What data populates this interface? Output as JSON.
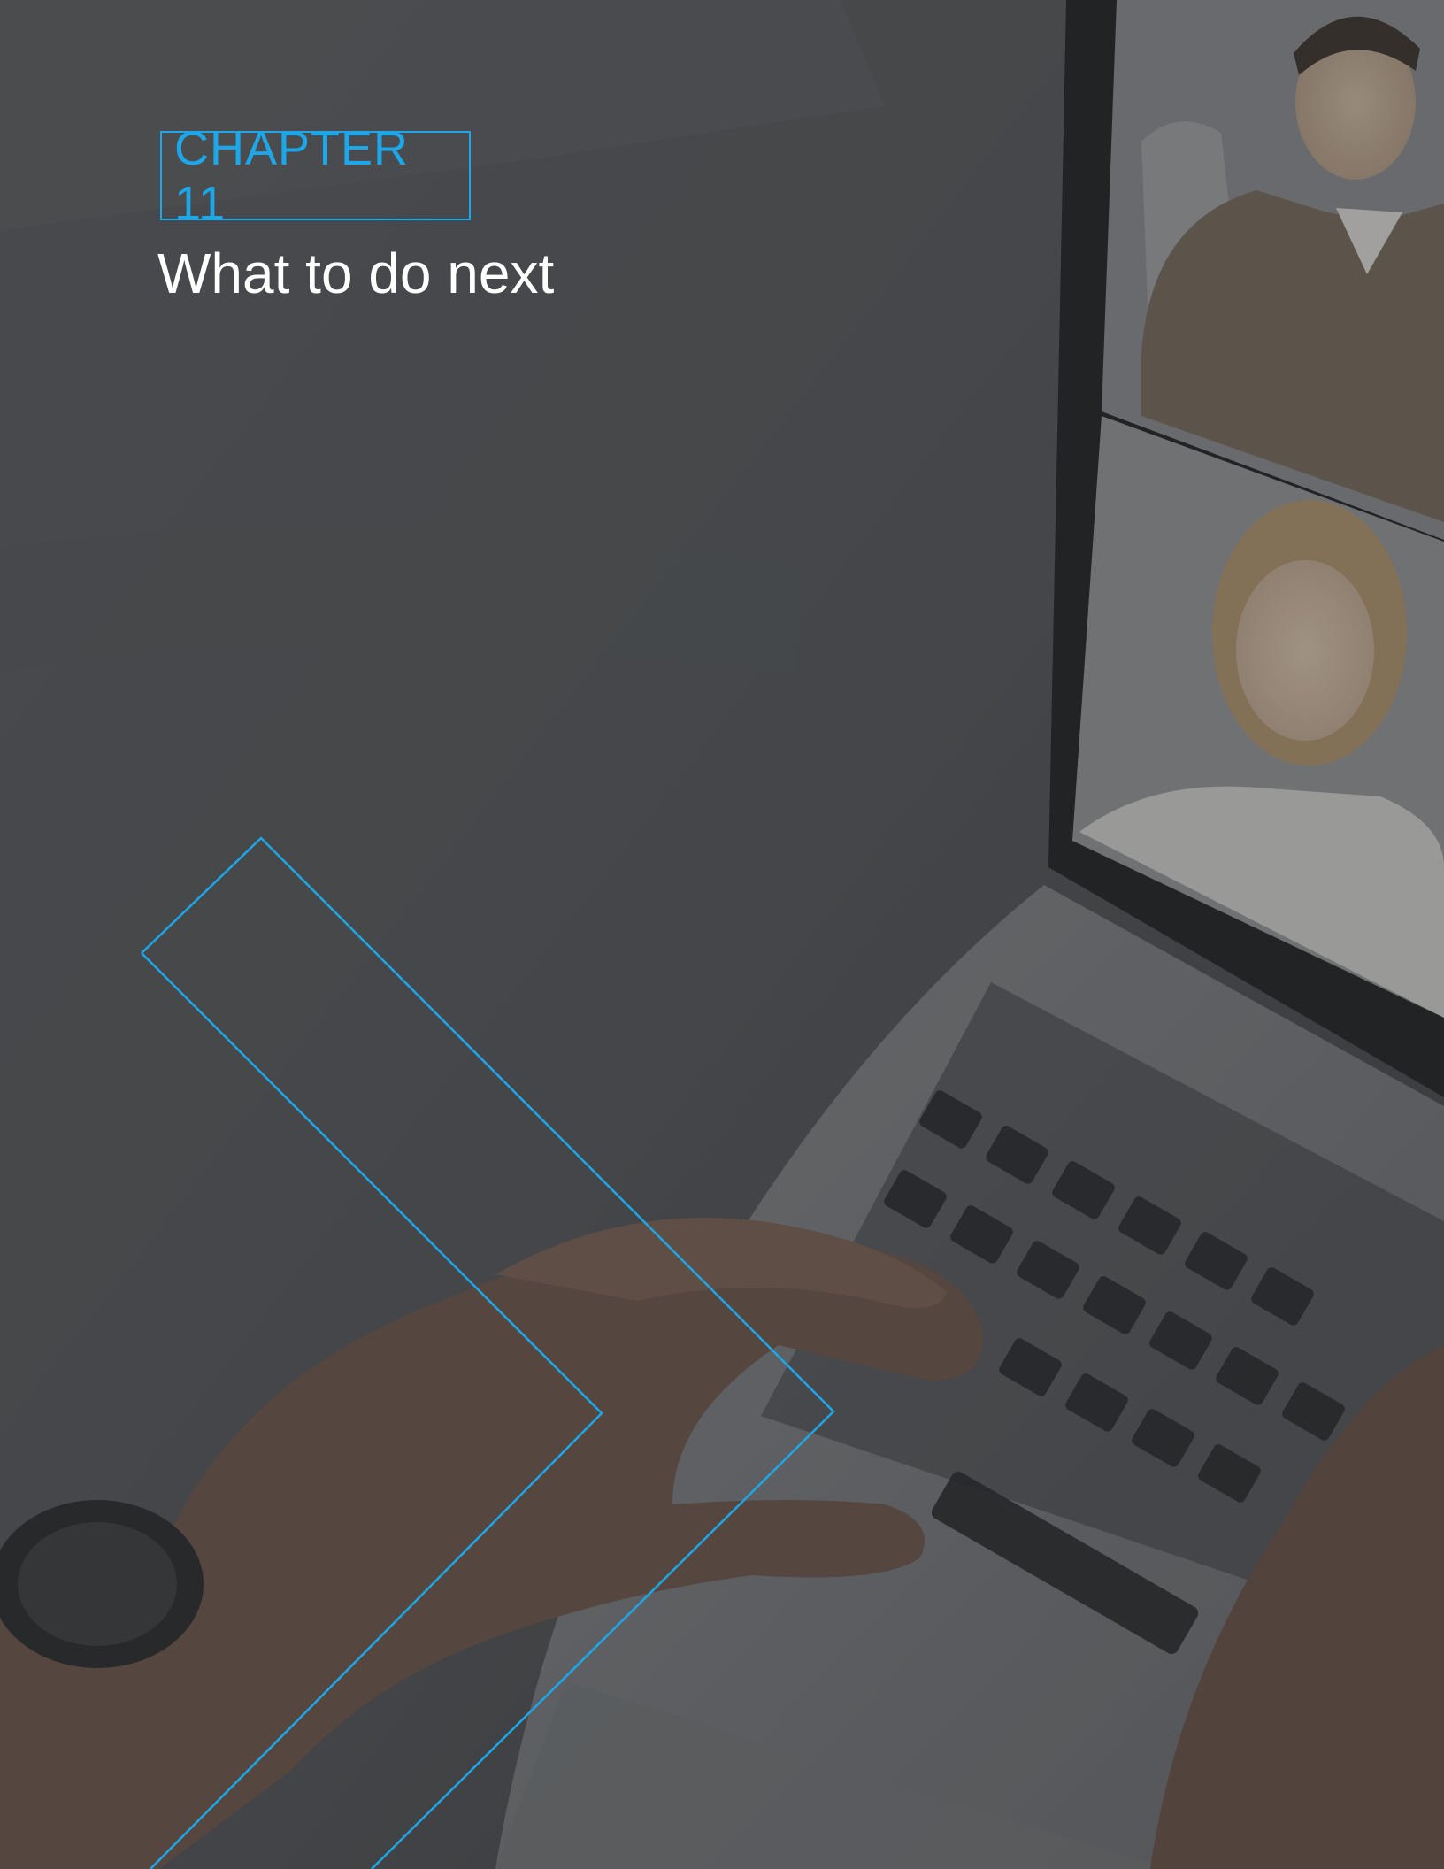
{
  "chapter": {
    "label": "CHAPTER 11",
    "title": "What to do next"
  },
  "background": {
    "photo_description_icon": "laptop-video-call-photo",
    "overlay_color": "#3e3f42"
  },
  "colors": {
    "accent": "#1ea7e8",
    "title": "#ffffff"
  }
}
